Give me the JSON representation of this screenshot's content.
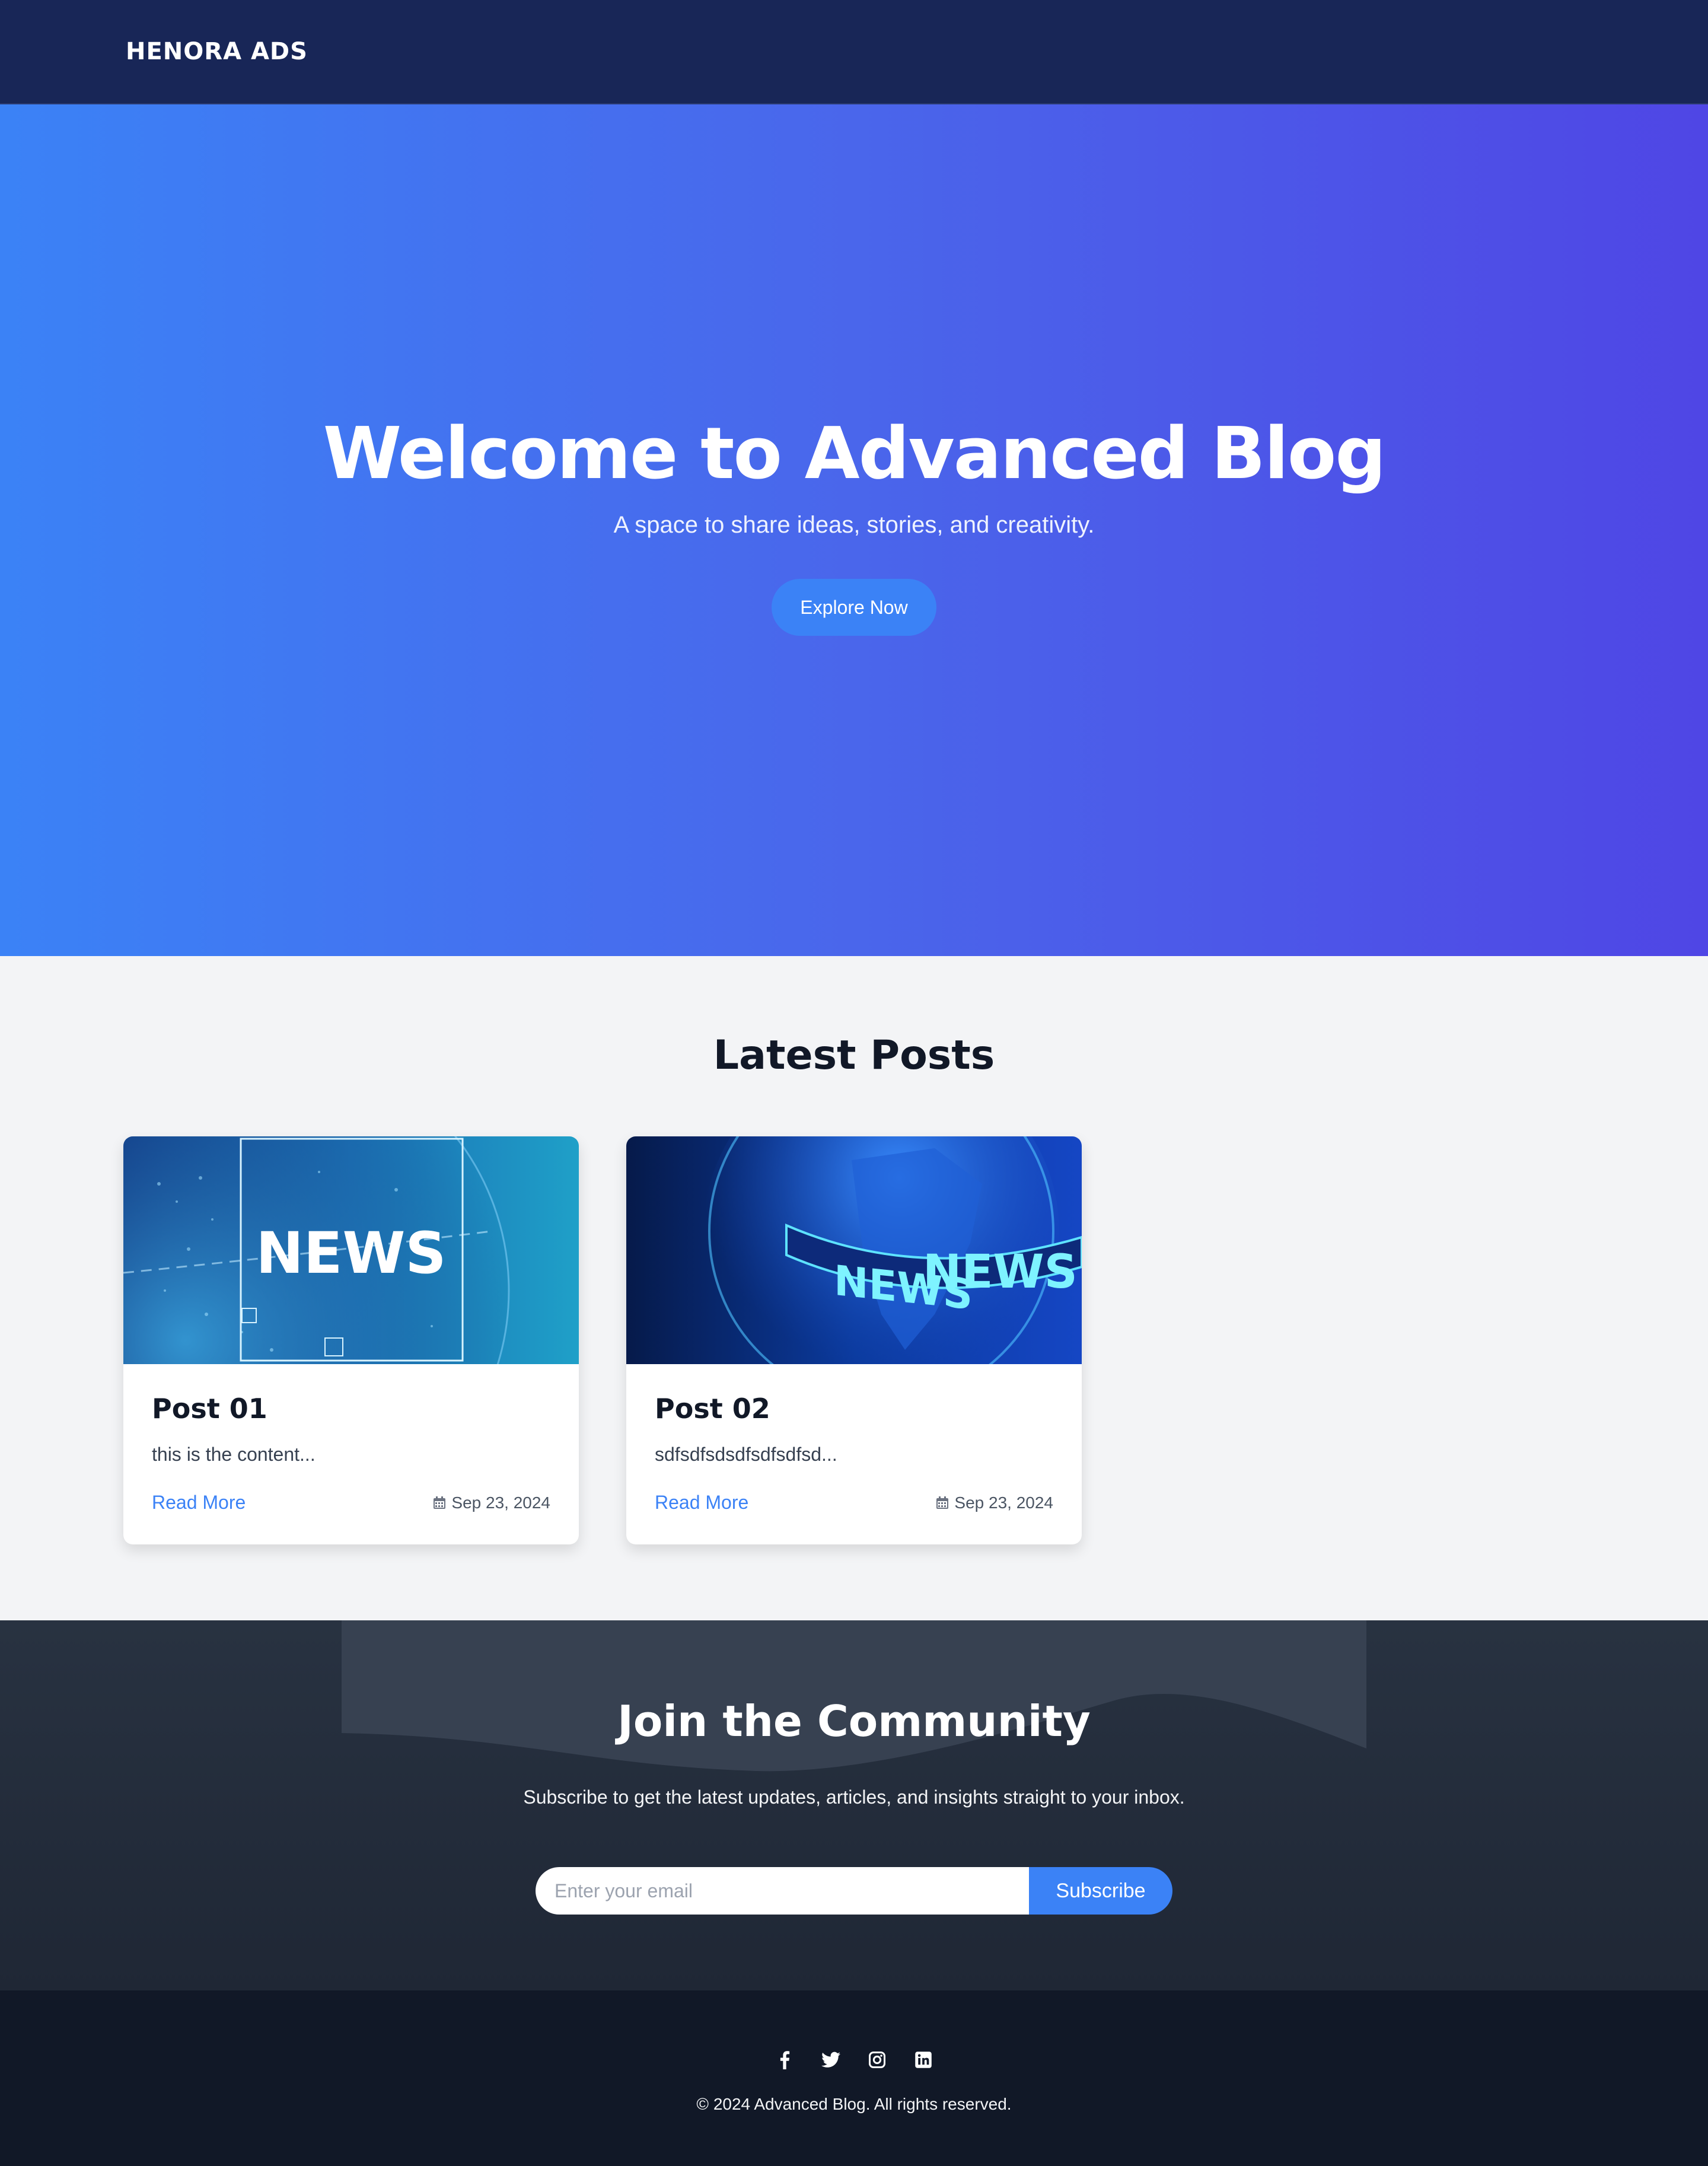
{
  "navbar": {
    "logo": "HENORA ADS"
  },
  "hero": {
    "title": "Welcome to Advanced Blog",
    "subtitle": "A space to share ideas, stories, and creativity.",
    "button_label": "Explore Now"
  },
  "posts": {
    "section_title": "Latest Posts",
    "items": [
      {
        "title": "Post 01",
        "excerpt": "this is the content...",
        "read_more": "Read More",
        "date": "Sep 23, 2024",
        "image_text": "NEWS"
      },
      {
        "title": "Post 02",
        "excerpt": "sdfsdfsdsdfsdfsdfsd...",
        "read_more": "Read More",
        "date": "Sep 23, 2024",
        "image_text": "NEWS"
      }
    ]
  },
  "community": {
    "title": "Join the Community",
    "text": "Subscribe to get the latest updates, articles, and insights straight to your inbox.",
    "email_placeholder": "Enter your email",
    "subscribe_label": "Subscribe"
  },
  "footer": {
    "social_icons": [
      "facebook-icon",
      "twitter-icon",
      "instagram-icon",
      "linkedin-icon"
    ],
    "copyright": "© 2024 Advanced Blog. All rights reserved."
  },
  "colors": {
    "navbar": "#182657",
    "hero_start": "#3b82f6",
    "hero_end": "#4f46e5",
    "accent": "#3b82f6",
    "footer": "#111827"
  }
}
